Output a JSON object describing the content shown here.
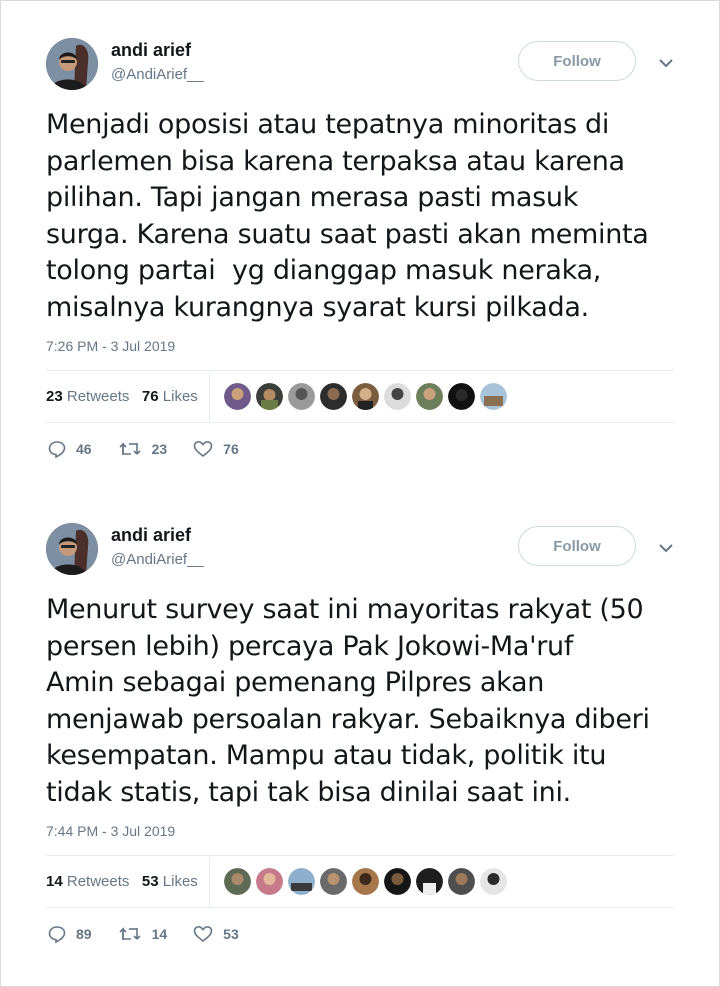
{
  "follow_label": "Follow",
  "tweets": [
    {
      "author_name": "andi arief",
      "author_handle": "@AndiArief__",
      "text": "Menjadi oposisi atau tepatnya minoritas di\nparlemen bisa karena terpaksa atau karena\npilihan. Tapi jangan merasa pasti masuk\nsurga. Karena suatu saat pasti akan meminta\ntolong partai  yg dianggap masuk neraka,\nmisalnya kurangnya syarat kursi pilkada.",
      "timestamp": "7:26 PM - 3 Jul 2019",
      "retweets_count": "23",
      "retweets_label": "Retweets",
      "likes_count": "76",
      "likes_label": "Likes",
      "reply_count": "46",
      "retweet_count": "23",
      "like_count": "76"
    },
    {
      "author_name": "andi arief",
      "author_handle": "@AndiArief__",
      "text": "Menurut survey saat ini mayoritas rakyat (50\npersen lebih) percaya Pak Jokowi-Ma'ruf\nAmin sebagai pemenang Pilpres akan\nmenjawab persoalan rakyar. Sebaiknya diberi\nkesempatan. Mampu atau tidak, politik itu\ntidak statis, tapi tak bisa dinilai saat ini.",
      "timestamp": "7:44 PM - 3 Jul 2019",
      "retweets_count": "14",
      "retweets_label": "Retweets",
      "likes_count": "53",
      "likes_label": "Likes",
      "reply_count": "89",
      "retweet_count": "14",
      "like_count": "53"
    }
  ],
  "colors": {
    "muted": "#657786",
    "text": "#14171a",
    "divider": "#e6ecf0"
  }
}
